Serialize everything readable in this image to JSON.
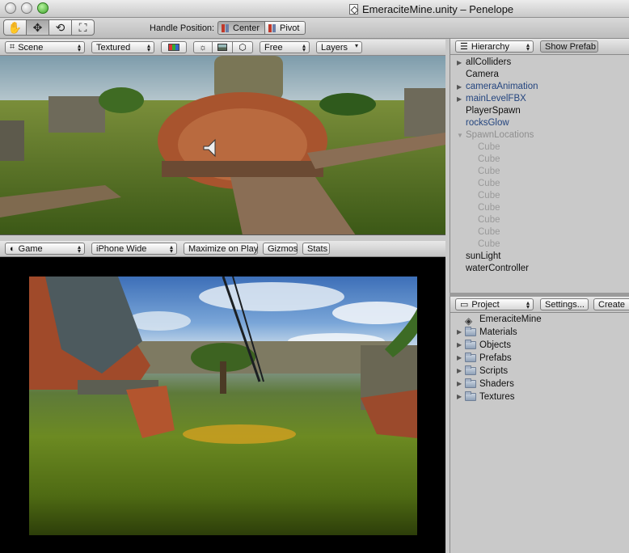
{
  "window": {
    "title": "EmeraciteMine.unity – Penelope"
  },
  "toolbar": {
    "tools": [
      {
        "name": "hand-tool-button",
        "glyph": "✋"
      },
      {
        "name": "move-tool-button",
        "glyph": "✥"
      },
      {
        "name": "rotate-tool-button",
        "glyph": "⟲"
      },
      {
        "name": "scale-tool-button",
        "glyph": "⛶"
      }
    ],
    "handle_label": "Handle Position:",
    "center_label": "Center",
    "pivot_label": "Pivot"
  },
  "scene": {
    "view_dropdown": "Scene",
    "render_mode": "Textured",
    "camera_mode": "Free",
    "layers": "Layers"
  },
  "game": {
    "view_dropdown": "Game",
    "aspect": "iPhone Wide",
    "maximize": "Maximize on Play",
    "gizmos": "Gizmos",
    "stats": "Stats"
  },
  "hierarchy": {
    "dropdown": "Hierarchy",
    "show_prefab": "Show Prefab",
    "items": [
      {
        "label": "allColliders",
        "expandable": true,
        "style": "normal"
      },
      {
        "label": "Camera",
        "expandable": false,
        "style": "normal"
      },
      {
        "label": "cameraAnimation",
        "expandable": true,
        "style": "link"
      },
      {
        "label": "mainLevelFBX",
        "expandable": true,
        "style": "link"
      },
      {
        "label": "PlayerSpawn",
        "expandable": false,
        "style": "normal"
      },
      {
        "label": "rocksGlow",
        "expandable": false,
        "style": "link"
      },
      {
        "label": "SpawnLocations",
        "expandable": true,
        "expanded": true,
        "style": "dim"
      },
      {
        "label": "Cube",
        "child": true
      },
      {
        "label": "Cube",
        "child": true
      },
      {
        "label": "Cube",
        "child": true
      },
      {
        "label": "Cube",
        "child": true
      },
      {
        "label": "Cube",
        "child": true
      },
      {
        "label": "Cube",
        "child": true
      },
      {
        "label": "Cube",
        "child": true
      },
      {
        "label": "Cube",
        "child": true
      },
      {
        "label": "Cube",
        "child": true
      },
      {
        "label": "sunLight",
        "expandable": false,
        "style": "normal"
      },
      {
        "label": "waterController",
        "expandable": false,
        "style": "normal"
      }
    ]
  },
  "project": {
    "dropdown": "Project",
    "settings": "Settings...",
    "create": "Create",
    "root": "EmeraciteMine",
    "folders": [
      "Materials",
      "Objects",
      "Prefabs",
      "Scripts",
      "Shaders",
      "Textures"
    ]
  },
  "colors": {
    "link": "#24457f",
    "dim": "#8f8f8f",
    "panel": "#c9c9c9"
  }
}
